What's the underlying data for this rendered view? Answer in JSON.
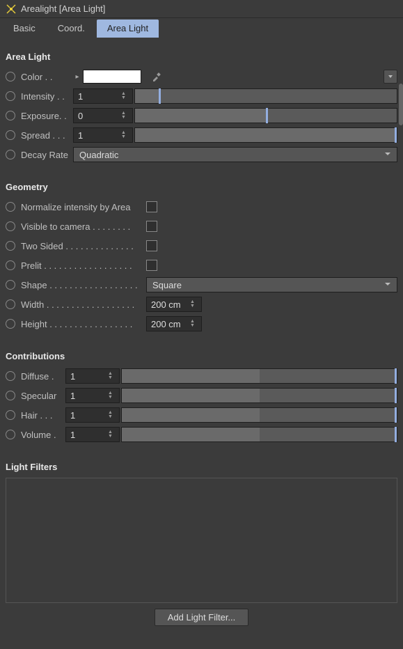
{
  "header": {
    "title": "Arealight [Area Light]"
  },
  "tabs": [
    "Basic",
    "Coord.",
    "Area Light"
  ],
  "active_tab": 2,
  "section_arealight": "Area Light",
  "section_geometry": "Geometry",
  "section_contributions": "Contributions",
  "section_lightfilters": "Light Filters",
  "arealight": {
    "color_label": "Color . .",
    "color_value": "#ffffff",
    "intensity_label": "Intensity . .",
    "intensity_value": "1",
    "intensity_fillpct": 9,
    "exposure_label": "Exposure. .",
    "exposure_value": "0",
    "exposure_fillpct": 50,
    "spread_label": "Spread . . .",
    "spread_value": "1",
    "spread_fillpct": 100,
    "decay_label": "Decay Rate",
    "decay_value": "Quadratic"
  },
  "geometry": {
    "normalize_label": "Normalize intensity by Area",
    "visible_label": "Visible to camera . . . . . . . .",
    "twosided_label": "Two Sided . . . . . . . . . . . . . .",
    "prelit_label": "Prelit  . . . . . . . . . . . . . . . . . .",
    "shape_label": "Shape . . . . . . . . . . . . . . . . . .",
    "shape_value": "Square",
    "width_label": "Width . . . . . . . . . . . . . . . . . .",
    "width_value": "200 cm",
    "height_label": "Height  . . . . . . . . . . . . . . . . .",
    "height_value": "200 cm"
  },
  "contributions": {
    "diffuse_label": "Diffuse .",
    "diffuse_value": "1",
    "specular_label": "Specular",
    "specular_value": "1",
    "hair_label": "Hair . . .",
    "hair_value": "1",
    "volume_label": "Volume .",
    "volume_value": "1"
  },
  "buttons": {
    "add_light_filter": "Add Light Filter..."
  }
}
